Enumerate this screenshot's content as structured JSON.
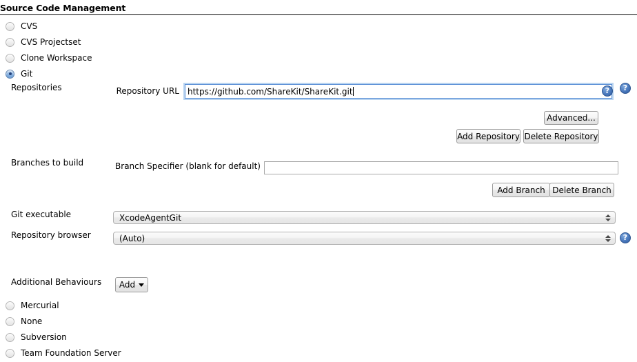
{
  "section": {
    "title": "Source Code Management"
  },
  "scm_options_top": [
    {
      "label": "CVS",
      "checked": false
    },
    {
      "label": "CVS Projectset",
      "checked": false
    },
    {
      "label": "Clone Workspace",
      "checked": false
    },
    {
      "label": "Git",
      "checked": true
    }
  ],
  "git": {
    "repositories_label": "Repositories",
    "repository_url_label": "Repository URL",
    "repository_url_value": "https://github.com/ShareKit/ShareKit.git",
    "repository_url_help": "?",
    "repositories_help": "?",
    "advanced_button": "Advanced...",
    "add_repository_button": "Add Repository",
    "delete_repository_button": "Delete Repository",
    "branches_label": "Branches to build",
    "branch_specifier_label": "Branch Specifier (blank for default)",
    "branch_specifier_value": "",
    "add_branch_button": "Add Branch",
    "delete_branch_button": "Delete Branch",
    "git_executable_label": "Git executable",
    "git_executable_value": "XcodeAgentGit",
    "repository_browser_label": "Repository browser",
    "repository_browser_value": "(Auto)",
    "repository_browser_help": "?",
    "additional_behaviours_label": "Additional Behaviours",
    "add_behaviour_button": "Add"
  },
  "scm_options_bottom": [
    {
      "label": "Mercurial",
      "checked": false
    },
    {
      "label": "None",
      "checked": false
    },
    {
      "label": "Subversion",
      "checked": false
    },
    {
      "label": "Team Foundation Server",
      "checked": false
    }
  ],
  "colors": {
    "accent_blue": "#4a79bd",
    "focus_border": "#5a8fd6",
    "focus_glow": "#b9d4f0",
    "radio_checked_dot": "#23417a",
    "rule": "#000000",
    "background": "#ffffff"
  }
}
